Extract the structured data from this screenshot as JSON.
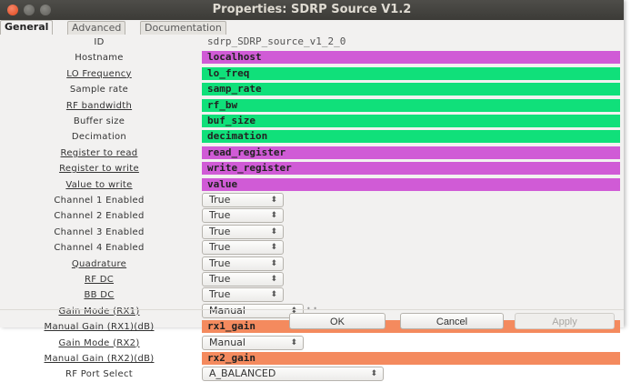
{
  "window": {
    "title": "Properties: SDRP Source V1.2"
  },
  "tabs": [
    {
      "label": "General"
    },
    {
      "label": "Advanced"
    },
    {
      "label": "Documentation"
    }
  ],
  "colors": {
    "string_param": "#d05bd6",
    "numeric_param": "#10e07a",
    "complex_param": "#f48a5e",
    "title_bar": "#3c3b37"
  },
  "params": [
    {
      "label": "ID",
      "value": "sdrp_SDRP_source_v1_2_0",
      "type": "text"
    },
    {
      "label": "Hostname",
      "value": "localhost",
      "type": "string"
    },
    {
      "label": "LO Frequency",
      "value": "lo_freq",
      "type": "numeric"
    },
    {
      "label": "Sample rate",
      "value": "samp_rate",
      "type": "numeric"
    },
    {
      "label": "RF bandwidth",
      "value": "rf_bw",
      "type": "numeric"
    },
    {
      "label": "Buffer size",
      "value": "buf_size",
      "type": "numeric"
    },
    {
      "label": "Decimation",
      "value": "decimation",
      "type": "numeric"
    },
    {
      "label": "Register to read",
      "value": "read_register",
      "type": "string"
    },
    {
      "label": "Register to write",
      "value": "write_register",
      "type": "string"
    },
    {
      "label": "Value to write",
      "value": "value",
      "type": "string"
    },
    {
      "label": "Channel 1 Enabled",
      "value": "True",
      "type": "combo"
    },
    {
      "label": "Channel 2 Enabled",
      "value": "True",
      "type": "combo"
    },
    {
      "label": "Channel 3 Enabled",
      "value": "True",
      "type": "combo"
    },
    {
      "label": "Channel 4 Enabled",
      "value": "True",
      "type": "combo"
    },
    {
      "label": "Quadrature",
      "value": "True",
      "type": "combo"
    },
    {
      "label": "RF DC",
      "value": "True",
      "type": "combo"
    },
    {
      "label": "BB DC",
      "value": "True",
      "type": "combo"
    },
    {
      "label": "Gain Mode (RX1)",
      "value": "Manual",
      "type": "combo"
    },
    {
      "label": "Manual Gain (RX1)(dB)",
      "value": "rx1_gain",
      "type": "complex"
    },
    {
      "label": "Gain Mode (RX2)",
      "value": "Manual",
      "type": "combo"
    },
    {
      "label": "Manual Gain (RX2)(dB)",
      "value": "rx2_gain",
      "type": "complex"
    },
    {
      "label": "RF Port Select",
      "value": "A_BALANCED",
      "type": "combo"
    }
  ],
  "buttons": {
    "ok": "OK",
    "cancel": "Cancel",
    "apply": "Apply"
  }
}
